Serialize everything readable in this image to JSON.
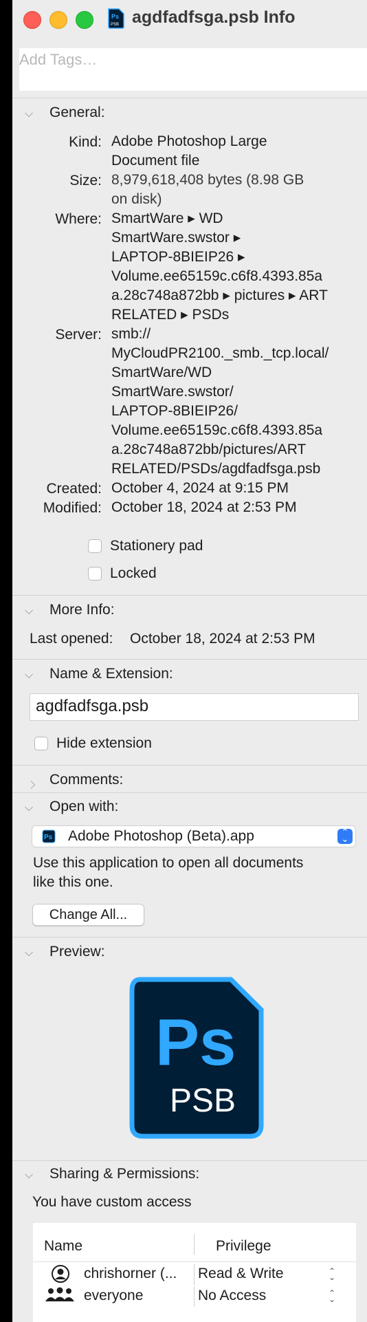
{
  "window": {
    "title": "agdfadfsga.psb Info",
    "icon": "psb-file-icon"
  },
  "tags": {
    "placeholder": "Add Tags…"
  },
  "general": {
    "header": "General:",
    "kind_label": "Kind:",
    "kind_value": [
      "Adobe Photoshop Large",
      "Document file"
    ],
    "size_label": "Size:",
    "size_value": [
      "8,979,618,408 bytes (8.98 GB",
      "on disk)"
    ],
    "where_label": "Where:",
    "where_value": [
      "SmartWare ▸ WD",
      "SmartWare.swstor ▸",
      "LAPTOP-8BIEIP26 ▸",
      "Volume.ee65159c.c6f8.4393.85a",
      "a.28c748a872bb ▸ pictures ▸ ART",
      "RELATED ▸ PSDs"
    ],
    "server_label": "Server:",
    "server_value": [
      "smb://",
      "MyCloudPR2100._smb._tcp.local/",
      "SmartWare/WD",
      "SmartWare.swstor/",
      "LAPTOP-8BIEIP26/",
      "Volume.ee65159c.c6f8.4393.85a",
      "a.28c748a872bb/pictures/ART",
      "RELATED/PSDs/agdfadfsga.psb"
    ],
    "created_label": "Created:",
    "created_value": "October 4, 2024 at 9:15 PM",
    "modified_label": "Modified:",
    "modified_value": "October 18, 2024 at 2:53 PM",
    "stationery_label": "Stationery pad",
    "stationery_checked": false,
    "locked_label": "Locked",
    "locked_checked": false
  },
  "more_info": {
    "header": "More Info:",
    "last_opened_label": "Last opened:",
    "last_opened_value": "October 18, 2024 at 2:53 PM"
  },
  "name_extension": {
    "header": "Name & Extension:",
    "name_value": "agdfadfsga.psb",
    "hide_extension_label": "Hide extension",
    "hide_extension_checked": false
  },
  "comments": {
    "header": "Comments:"
  },
  "open_with": {
    "header": "Open with:",
    "app": "Adobe Photoshop (Beta).app",
    "description": [
      "Use this application to open all documents",
      "like this one."
    ],
    "change_all": "Change All..."
  },
  "preview": {
    "header": "Preview:",
    "icon_text_ps": "Ps",
    "icon_text_psb": "PSB"
  },
  "sharing": {
    "header": "Sharing & Permissions:",
    "access_text": "You have custom access",
    "columns": [
      "Name",
      "Privilege"
    ],
    "rows": [
      {
        "name": "chrishorner (...",
        "privilege": "Read & Write",
        "icon": "user-icon"
      },
      {
        "name": "everyone",
        "privilege": "No Access",
        "icon": "group-icon"
      }
    ]
  },
  "colors": {
    "accent": "#2f7cf6",
    "ps_dark": "#001e36",
    "ps_blue": "#31a8ff"
  }
}
